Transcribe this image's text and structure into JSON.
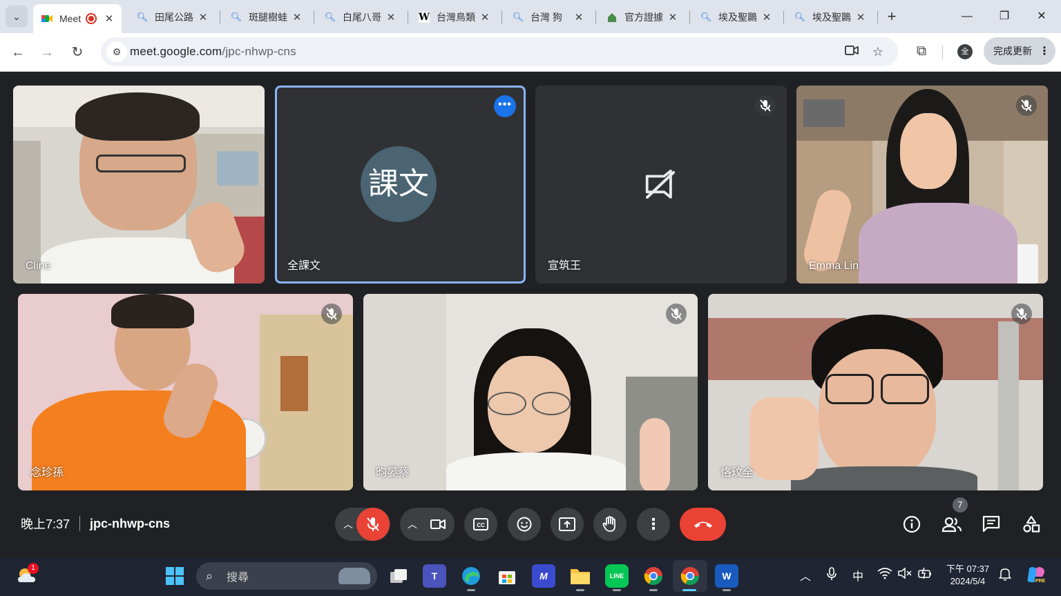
{
  "browser": {
    "tabs": [
      {
        "label": "Meet",
        "icon": "google-meet-icon",
        "active": true,
        "recording": true
      },
      {
        "label": "田尾公路",
        "icon": "search-icon"
      },
      {
        "label": "斑腿樹蛙",
        "icon": "search-icon"
      },
      {
        "label": "白尾八哥",
        "icon": "search-icon"
      },
      {
        "label": "台灣鳥類",
        "icon": "wikipedia-icon"
      },
      {
        "label": "台灣 狗",
        "icon": "search-icon"
      },
      {
        "label": "官方證據",
        "icon": "house-icon"
      },
      {
        "label": "埃及聖䴉",
        "icon": "search-icon"
      },
      {
        "label": "埃及聖䴉",
        "icon": "search-icon"
      }
    ],
    "url_host": "meet.google.com",
    "url_path": "/jpc-nhwp-cns",
    "profile_initial": "全",
    "update_label": "完成更新"
  },
  "participants": [
    {
      "name": "Cline",
      "type": "video",
      "muted": false
    },
    {
      "name": "全課文",
      "type": "avatar",
      "avatar_text": "課文",
      "selected": true
    },
    {
      "name": "宣筑王",
      "type": "camera-off",
      "muted": true
    },
    {
      "name": "Emma Lin",
      "type": "video",
      "muted": true
    },
    {
      "name": "念珍孫",
      "type": "video",
      "muted": true
    },
    {
      "name": "昀晏蔡",
      "type": "video",
      "muted": true
    },
    {
      "name": "恪玟全",
      "type": "video",
      "muted": true
    }
  ],
  "meeting": {
    "time": "晚上7:37",
    "code": "jpc-nhwp-cns",
    "participant_count": "7"
  },
  "taskbar": {
    "search_placeholder": "搜尋",
    "weather_badge": "1",
    "ime": "中",
    "clock_time": "下午 07:37",
    "clock_date": "2024/5/4"
  },
  "colors": {
    "meet_bg": "#202124",
    "tile_bg": "#3c4043",
    "hangup_red": "#ea4335",
    "selected_outline": "#8ab4f8",
    "avatar_bg": "#4a6472"
  }
}
